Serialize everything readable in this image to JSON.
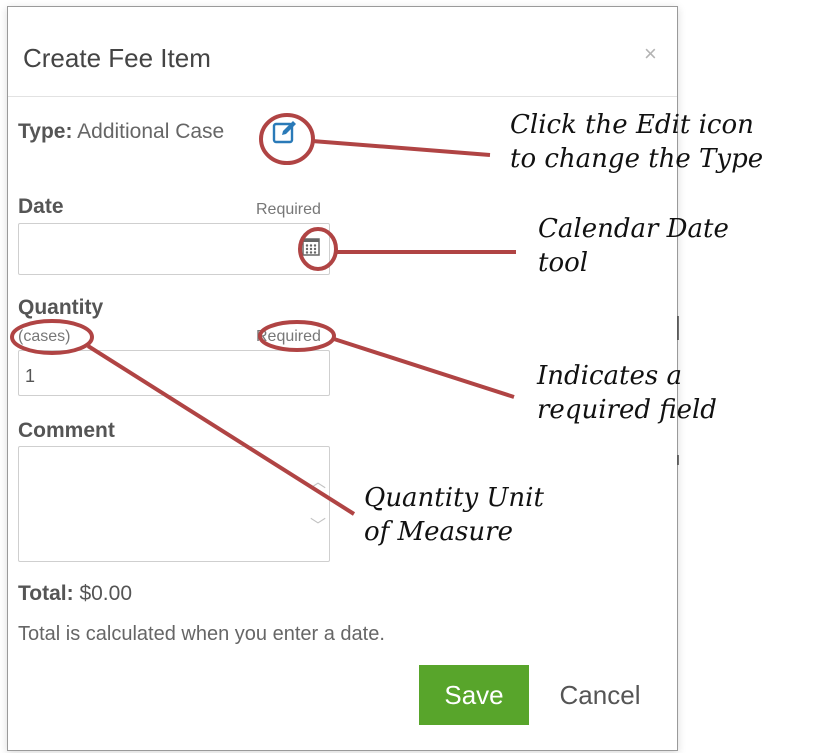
{
  "dialog": {
    "title": "Create Fee Item",
    "close": "×"
  },
  "type_field": {
    "label": "Type:",
    "value": "Additional Case"
  },
  "date_field": {
    "label": "Date",
    "required": "Required",
    "value": ""
  },
  "quantity_field": {
    "label": "Quantity",
    "unit": "(cases)",
    "required": "Required",
    "value": "1"
  },
  "comment_field": {
    "label": "Comment",
    "value": ""
  },
  "total": {
    "label": "Total:",
    "value": "$0.00",
    "note": "Total is calculated when you enter a date."
  },
  "buttons": {
    "save": "Save",
    "cancel": "Cancel"
  },
  "callouts": {
    "edit_line1": "Click the Edit icon",
    "edit_line2": "to change the Type",
    "calendar_line1": "Calendar Date",
    "calendar_line2": "tool",
    "required_line1": "Indicates a",
    "required_line2": "required field",
    "unit_line1": "Quantity Unit",
    "unit_line2": "of Measure"
  },
  "colors": {
    "save_button": "#58a52b",
    "edit_icon": "#2a7ab8",
    "annotation": "#b04444"
  }
}
